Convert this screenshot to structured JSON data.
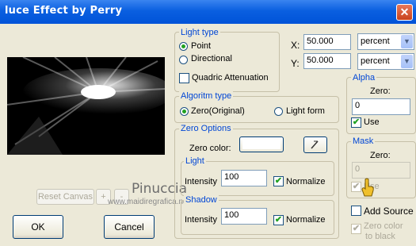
{
  "window": {
    "title": "luce Effect by Perry",
    "close_glyph": "✕"
  },
  "light_type": {
    "group_label": "Light type",
    "options": [
      "Point",
      "Directional"
    ],
    "selected": "Point",
    "quadric_label": "Quadric Attenuation",
    "quadric_checked": false
  },
  "position": {
    "x_label": "X:",
    "x_value": "50.000",
    "x_unit": "percent",
    "y_label": "Y:",
    "y_value": "50.000",
    "y_unit": "percent"
  },
  "algorithm": {
    "group_label": "Algoritm type",
    "options": [
      "Zero(Original)",
      "Light form"
    ],
    "selected": "Zero(Original)"
  },
  "zero_options": {
    "group_label": "Zero Options",
    "color_label": "Zero color:",
    "light": {
      "label": "Light",
      "intensity_label": "Intensity",
      "intensity": "100",
      "normalize_label": "Normalize",
      "normalize": true
    },
    "shadow": {
      "label": "Shadow",
      "intensity_label": "Intensity",
      "intensity": "100",
      "normalize_label": "Normalize",
      "normalize": true
    }
  },
  "alpha": {
    "group_label": "Alpha",
    "zero_label": "Zero:",
    "zero_value": "0",
    "use_label": "Use",
    "use_checked": true
  },
  "mask": {
    "group_label": "Mask",
    "zero_label": "Zero:",
    "zero_value": "0",
    "use_label": "Use",
    "use_checked": true
  },
  "add_source": {
    "label": "Add Source",
    "checked": false
  },
  "zero_color_black": {
    "label_line1": "Zero color",
    "label_line2": "to black",
    "checked": true
  },
  "buttons": {
    "reset": "Reset Canvas",
    "plus": "+",
    "minus": "-",
    "ok": "OK",
    "cancel": "Cancel"
  },
  "watermark": {
    "name": "Pinuccia",
    "url": "www.maidiregrafica.net"
  },
  "colors": {
    "title_bar": "#0a5fe0",
    "group_label": "#0046d5",
    "dialog_bg": "#ece9d8",
    "check_mark": "#21a121"
  }
}
